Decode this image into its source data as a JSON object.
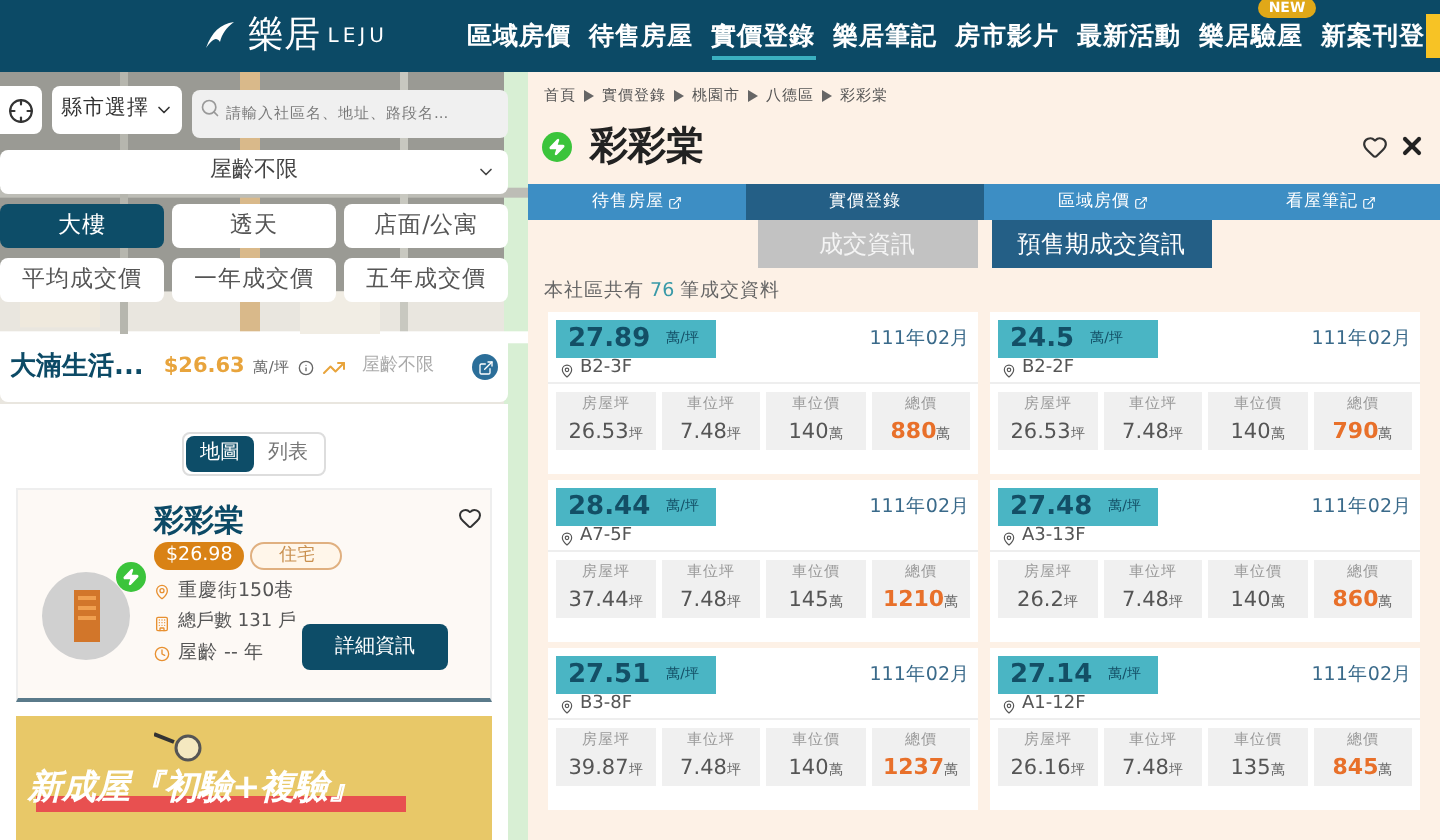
{
  "nav": {
    "logo_text": "樂居",
    "logo_sub": "LEJU",
    "items": [
      {
        "label": "區域房價",
        "selected": false
      },
      {
        "label": "待售房屋",
        "selected": false
      },
      {
        "label": "實價登錄",
        "selected": true
      },
      {
        "label": "樂居筆記",
        "selected": false
      },
      {
        "label": "房市影片",
        "selected": false
      },
      {
        "label": "最新活動",
        "selected": false
      },
      {
        "label": "樂居驗屋",
        "selected": false,
        "badge": "NEW"
      },
      {
        "label": "新案刊登",
        "selected": false
      }
    ]
  },
  "filters": {
    "county": "縣市選擇",
    "search_placeholder": "請輸入社區名、地址、路段名...",
    "age": "屋齡不限",
    "types": [
      {
        "label": "大樓",
        "selected": true
      },
      {
        "label": "透天",
        "selected": false
      },
      {
        "label": "店面/公寓",
        "selected": false
      }
    ],
    "price_periods": [
      {
        "label": "平均成交價",
        "selected": false
      },
      {
        "label": "一年成交價",
        "selected": false
      },
      {
        "label": "五年成交價",
        "selected": false
      }
    ]
  },
  "community_bar": {
    "name": "大湳生活...",
    "price": "$26.63",
    "unit": "萬/坪",
    "age": "屋齡不限"
  },
  "view_toggle": [
    {
      "label": "地圖",
      "selected": true
    },
    {
      "label": "列表",
      "selected": false
    }
  ],
  "card": {
    "name": "彩彩棠",
    "price": "$26.98",
    "tag": "住宅",
    "address": "重慶街150巷",
    "households": "總戶數 131 戶",
    "age": "屋齡 -- 年",
    "button": "詳細資訊"
  },
  "banner": {
    "headline": "新成屋『初驗+複驗』"
  },
  "detail": {
    "breadcrumb": [
      "首頁",
      "實價登錄",
      "桃園市",
      "八德區",
      "彩彩棠"
    ],
    "title": "彩彩棠",
    "tabs": [
      {
        "label": "待售房屋",
        "selected": false,
        "external": true
      },
      {
        "label": "實價登錄",
        "selected": true,
        "external": false
      },
      {
        "label": "區域房價",
        "selected": false,
        "external": true
      },
      {
        "label": "看屋筆記",
        "selected": false,
        "external": true
      }
    ],
    "subtabs": [
      {
        "label": "成交資訊",
        "selected": false
      },
      {
        "label": "預售期成交資訊",
        "selected": true
      }
    ],
    "count_prefix": "本社區共有",
    "count": "76",
    "count_suffix": "筆成交資料",
    "records": [
      {
        "price": "27.89",
        "unit": "萬/坪",
        "date": "111年02月",
        "unit_no": "B2-3F",
        "stats": [
          {
            "label": "房屋坪",
            "value": "26.53",
            "unit": "坪",
            "kind": "plain"
          },
          {
            "label": "車位坪",
            "value": "7.48",
            "unit": "坪",
            "kind": "plain"
          },
          {
            "label": "車位價",
            "value": "140",
            "unit": "萬",
            "kind": "plain"
          },
          {
            "label": "總價",
            "value": "880",
            "unit": "萬",
            "kind": "total"
          }
        ]
      },
      {
        "price": "24.5",
        "unit": "萬/坪",
        "date": "111年02月",
        "unit_no": "B2-2F",
        "stats": [
          {
            "label": "房屋坪",
            "value": "26.53",
            "unit": "坪",
            "kind": "plain"
          },
          {
            "label": "車位坪",
            "value": "7.48",
            "unit": "坪",
            "kind": "plain"
          },
          {
            "label": "車位價",
            "value": "140",
            "unit": "萬",
            "kind": "plain"
          },
          {
            "label": "總價",
            "value": "790",
            "unit": "萬",
            "kind": "total"
          }
        ]
      },
      {
        "price": "28.44",
        "unit": "萬/坪",
        "date": "111年02月",
        "unit_no": "A7-5F",
        "stats": [
          {
            "label": "房屋坪",
            "value": "37.44",
            "unit": "坪",
            "kind": "plain"
          },
          {
            "label": "車位坪",
            "value": "7.48",
            "unit": "坪",
            "kind": "plain"
          },
          {
            "label": "車位價",
            "value": "145",
            "unit": "萬",
            "kind": "plain"
          },
          {
            "label": "總價",
            "value": "1210",
            "unit": "萬",
            "kind": "total"
          }
        ]
      },
      {
        "price": "27.48",
        "unit": "萬/坪",
        "date": "111年02月",
        "unit_no": "A3-13F",
        "stats": [
          {
            "label": "房屋坪",
            "value": "26.2",
            "unit": "坪",
            "kind": "plain"
          },
          {
            "label": "車位坪",
            "value": "7.48",
            "unit": "坪",
            "kind": "plain"
          },
          {
            "label": "車位價",
            "value": "140",
            "unit": "萬",
            "kind": "plain"
          },
          {
            "label": "總價",
            "value": "860",
            "unit": "萬",
            "kind": "total"
          }
        ]
      },
      {
        "price": "27.51",
        "unit": "萬/坪",
        "date": "111年02月",
        "unit_no": "B3-8F",
        "stats": [
          {
            "label": "房屋坪",
            "value": "39.87",
            "unit": "坪",
            "kind": "plain"
          },
          {
            "label": "車位坪",
            "value": "7.48",
            "unit": "坪",
            "kind": "plain"
          },
          {
            "label": "車位價",
            "value": "140",
            "unit": "萬",
            "kind": "plain"
          },
          {
            "label": "總價",
            "value": "1237",
            "unit": "萬",
            "kind": "total"
          }
        ]
      },
      {
        "price": "27.14",
        "unit": "萬/坪",
        "date": "111年02月",
        "unit_no": "A1-12F",
        "stats": [
          {
            "label": "房屋坪",
            "value": "26.16",
            "unit": "坪",
            "kind": "plain"
          },
          {
            "label": "車位坪",
            "value": "7.48",
            "unit": "坪",
            "kind": "plain"
          },
          {
            "label": "車位價",
            "value": "135",
            "unit": "萬",
            "kind": "plain"
          },
          {
            "label": "總價",
            "value": "845",
            "unit": "萬",
            "kind": "total"
          }
        ]
      }
    ]
  }
}
